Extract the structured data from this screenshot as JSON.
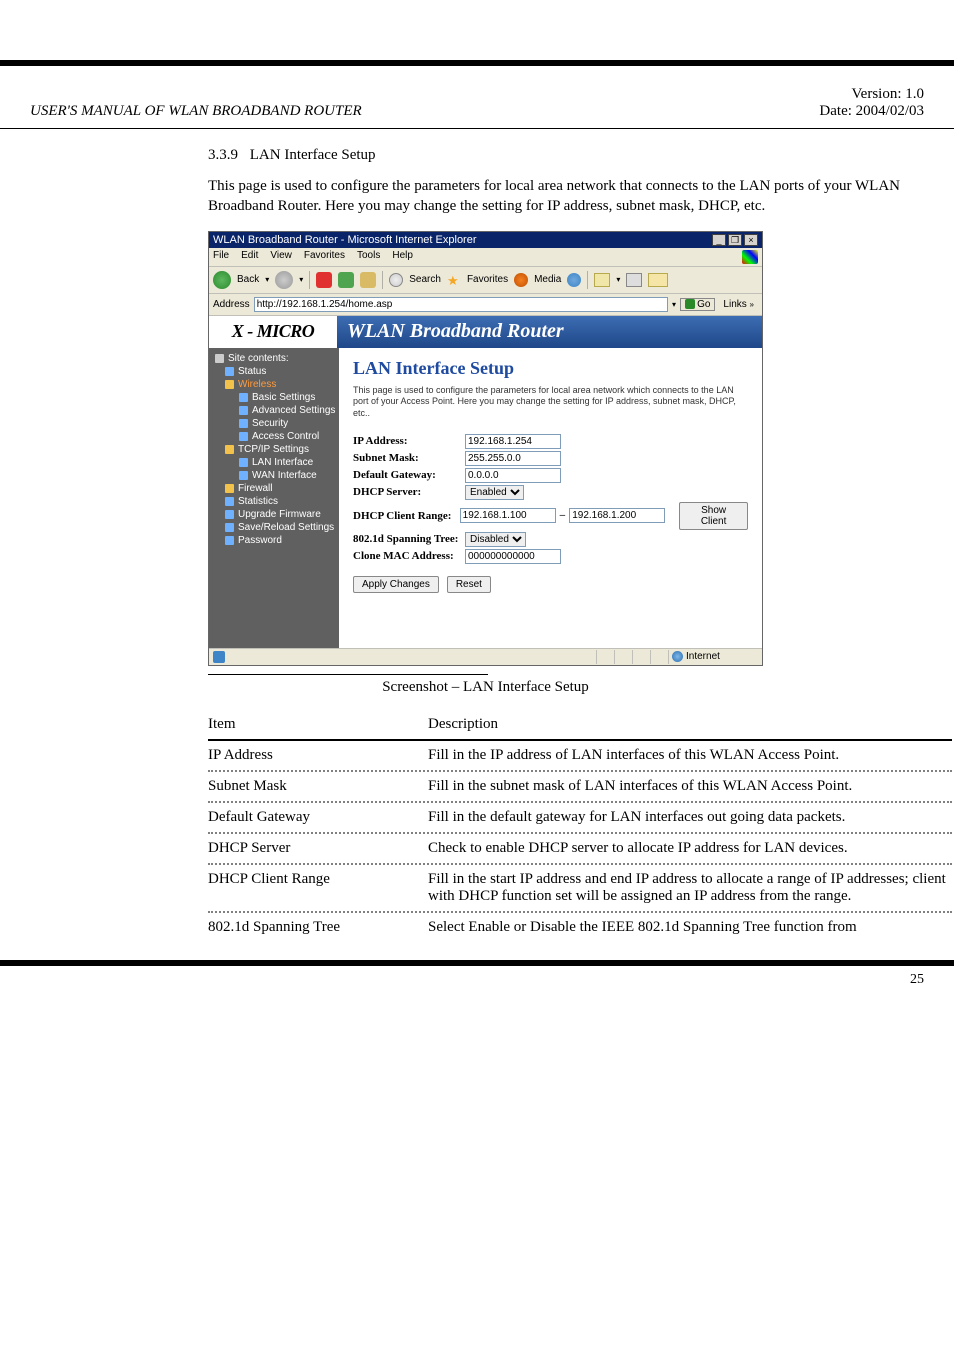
{
  "chapter": {
    "left": "USER'S MANUAL OF WLAN BROADBAND ROUTER",
    "right_top": "Version: 1.0",
    "right_bottom": "Date: 2004/02/03"
  },
  "section": {
    "number": "3.3.9",
    "title": "LAN Interface Setup",
    "body": "This page is used to configure the parameters for local area network that connects to the LAN ports of your WLAN Broadband Router. Here you may change the setting for IP address, subnet mask, DHCP, etc."
  },
  "browser": {
    "title": "WLAN Broadband Router - Microsoft Internet Explorer",
    "menus": [
      "File",
      "Edit",
      "View",
      "Favorites",
      "Tools",
      "Help"
    ],
    "toolbar": {
      "back": "Back",
      "search": "Search",
      "favorites": "Favorites",
      "media": "Media"
    },
    "address_label": "Address",
    "url": "http://192.168.1.254/home.asp",
    "go": "Go",
    "links": "Links"
  },
  "router": {
    "logo": "X - MICRO",
    "banner_title": "WLAN Broadband Router",
    "sidebar_root": "Site contents:",
    "sidebar_items": [
      {
        "label": "Status",
        "level": 1
      },
      {
        "label": "Wireless",
        "level": 1,
        "selected": true
      },
      {
        "label": "Basic Settings",
        "level": 2
      },
      {
        "label": "Advanced Settings",
        "level": 2
      },
      {
        "label": "Security",
        "level": 2
      },
      {
        "label": "Access Control",
        "level": 2
      },
      {
        "label": "TCP/IP Settings",
        "level": 1
      },
      {
        "label": "LAN Interface",
        "level": 2
      },
      {
        "label": "WAN Interface",
        "level": 2
      },
      {
        "label": "Firewall",
        "level": 1
      },
      {
        "label": "Statistics",
        "level": 1
      },
      {
        "label": "Upgrade Firmware",
        "level": 1
      },
      {
        "label": "Save/Reload Settings",
        "level": 1
      },
      {
        "label": "Password",
        "level": 1
      }
    ],
    "main": {
      "heading": "LAN Interface Setup",
      "desc": "This page is used to configure the parameters for local area network which connects to the LAN port of your Access Point. Here you may change the setting for IP address, subnet mask, DHCP, etc..",
      "fields": {
        "ip_label": "IP Address:",
        "ip_value": "192.168.1.254",
        "subnet_label": "Subnet Mask:",
        "subnet_value": "255.255.0.0",
        "gateway_label": "Default Gateway:",
        "gateway_value": "0.0.0.0",
        "dhcp_server_label": "DHCP Server:",
        "dhcp_server_value": "Enabled",
        "dhcp_range_label": "DHCP Client Range:",
        "dhcp_range_start": "192.168.1.100",
        "dhcp_range_end": "192.168.1.200",
        "show_client": "Show Client",
        "stp_label": "802.1d Spanning Tree:",
        "stp_value": "Disabled",
        "mac_label": "Clone MAC Address:",
        "mac_value": "000000000000",
        "apply": "Apply Changes",
        "reset": "Reset"
      }
    }
  },
  "statusbar": {
    "zone": "Internet"
  },
  "caption": "Screenshot – LAN Interface Setup",
  "definitions_header": {
    "item": "Item",
    "desc": "Description"
  },
  "definitions": [
    {
      "item": "IP Address",
      "desc": "Fill in the IP address of LAN interfaces of this WLAN Access Point."
    },
    {
      "item": "Subnet Mask",
      "desc": "Fill in the subnet mask of LAN interfaces of this WLAN Access Point."
    },
    {
      "item": "Default Gateway",
      "desc": "Fill in the default gateway for LAN interfaces out going data packets."
    },
    {
      "item": "DHCP Server",
      "desc": "Check to enable DHCP server to allocate IP address for LAN devices."
    },
    {
      "item": "DHCP Client Range",
      "desc": "Fill in the start IP address and end IP address to allocate a range of IP addresses; client with DHCP function set will be assigned an IP address from the range."
    },
    {
      "item": "802.1d Spanning Tree",
      "desc": "Select Enable or Disable the IEEE 802.1d Spanning Tree function from"
    }
  ],
  "page_number": "25"
}
